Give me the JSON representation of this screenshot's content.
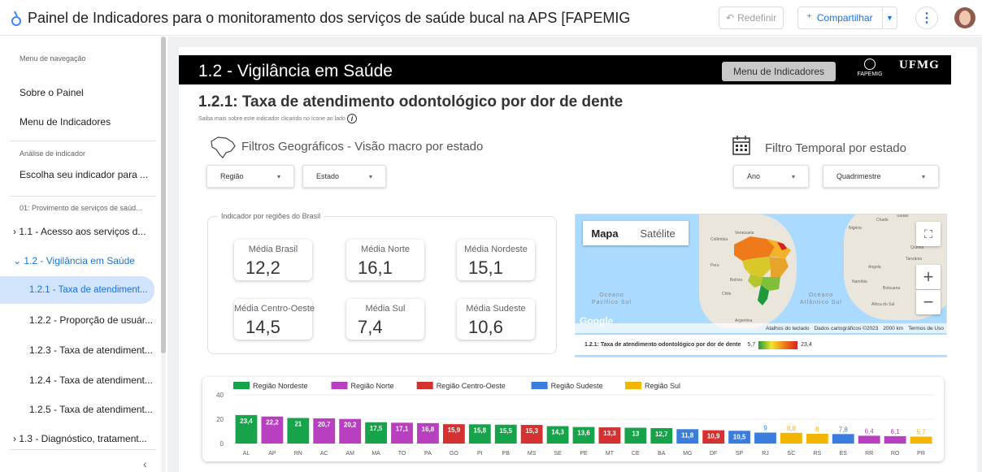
{
  "app": {
    "title": "Painel de Indicadores para o monitoramento dos serviços de saúde bucal na APS [FAPEMIG",
    "reset_label": "Redefinir",
    "share_label": "Compartilhar"
  },
  "sidebar": {
    "nav_caption": "Menu de navegação",
    "items_top": [
      "Sobre o Painel",
      "Menu de Indicadores"
    ],
    "analysis_caption": "Análise de indicador",
    "analysis_item": "Escolha seu indicador para ...",
    "section_caption": "01: Provimento de serviços de saúd...",
    "groups": [
      "› 1.1 - Acesso aos serviços d...",
      "⌄ 1.2 - Vigilância em Saúde"
    ],
    "sub_items": [
      "1.2.1 - Taxa de atendiment...",
      "1.2.2 - Proporção de usuár...",
      "1.2.3 - Taxa de atendiment...",
      "1.2.4 - Taxa de atendiment...",
      "1.2.5 - Taxa de atendiment..."
    ],
    "last_group": "› 1.3 - Diagnóstico, tratament...",
    "active_index": 0
  },
  "header": {
    "title": "1.2 - Vigilância em Saúde",
    "menu_button": "Menu de Indicadores",
    "fapemig": "FAPEMIG",
    "ufmg": "UFMG"
  },
  "indicator": {
    "title": "1.2.1: Taxa de atendimento odontológico por dor de dente",
    "subtitle": "Saiba mais sobre este indicador clicando no ícone ao lado"
  },
  "filters": {
    "geo_title": "Filtros Geográficos - Visão macro por estado",
    "time_title": "Filtro Temporal por estado",
    "regiao": "Região",
    "estado": "Estado",
    "ano": "Ano",
    "quadrimestre": "Quadrimestre"
  },
  "regions": {
    "label": "Indicador por regiões do Brasil",
    "cards": [
      {
        "label": "Média Brasil",
        "value": "12,2"
      },
      {
        "label": "Média Norte",
        "value": "16,1"
      },
      {
        "label": "Média Nordeste",
        "value": "15,1"
      },
      {
        "label": "Média Centro-Oeste",
        "value": "14,5"
      },
      {
        "label": "Média Sul",
        "value": "7,4"
      },
      {
        "label": "Média Sudeste",
        "value": "10,6"
      }
    ]
  },
  "map": {
    "tab_map": "Mapa",
    "tab_satellite": "Satélite",
    "google": "Google",
    "footer": [
      "Atalhos do teclado",
      "Dados cartográficos ©2023",
      "2000 km",
      "Termos de Uso"
    ],
    "legend_label": "1.2.1: Taxa de atendimento odontológico por dor de dente",
    "legend_min": "5,7",
    "legend_max": "23,4",
    "ocean_pacific": "Oceano\nPacífico Sul",
    "ocean_atlantic": "Oceano\nAtlântico Sul",
    "places": [
      "Venezuela",
      "Colômbia",
      "Peru",
      "Bolívia",
      "Chile",
      "Argentina",
      "Chade",
      "Nigéria",
      "Sudão",
      "Quênia",
      "Tanzânia",
      "Angola",
      "Namíbia",
      "Botsuana",
      "África do Sul"
    ]
  },
  "colors": {
    "Nordeste": "#16a34a",
    "Norte": "#b83fbf",
    "Centro-Oeste": "#d63131",
    "Sudeste": "#3b7ddd",
    "Sul": "#f2b600"
  },
  "chart_data": {
    "type": "bar",
    "legend": [
      "Região Nordeste",
      "Região Norte",
      "Região Centro-Oeste",
      "Região Sudeste",
      "Região Sul"
    ],
    "legend_keys": [
      "Nordeste",
      "Norte",
      "Centro-Oeste",
      "Sudeste",
      "Sul"
    ],
    "categories": [
      "AL",
      "AP",
      "RN",
      "AC",
      "AM",
      "MA",
      "TO",
      "PA",
      "GO",
      "PI",
      "PB",
      "MS",
      "SE",
      "PE",
      "MT",
      "CE",
      "BA",
      "MG",
      "DF",
      "SP",
      "RJ",
      "SC",
      "RS",
      "ES",
      "RR",
      "RO",
      "PR"
    ],
    "values": [
      23.4,
      22.2,
      21,
      20.7,
      20.2,
      17.5,
      17.1,
      16.8,
      15.9,
      15.8,
      15.5,
      15.3,
      14.3,
      13.6,
      13.3,
      13,
      12.7,
      11.8,
      10.9,
      10.5,
      9,
      8.8,
      8,
      7.8,
      6.4,
      6.1,
      5.7
    ],
    "labels": [
      "23,4",
      "22,2",
      "21",
      "20,7",
      "20,2",
      "17,5",
      "17,1",
      "16,8",
      "15,9",
      "15,8",
      "15,5",
      "15,3",
      "14,3",
      "13,6",
      "13,3",
      "13",
      "12,7",
      "11,8",
      "10,9",
      "10,5",
      "9",
      "8,8",
      "8",
      "7,8",
      "6,4",
      "6,1",
      "5,7"
    ],
    "regions": [
      "Nordeste",
      "Norte",
      "Nordeste",
      "Norte",
      "Norte",
      "Nordeste",
      "Norte",
      "Norte",
      "Centro-Oeste",
      "Nordeste",
      "Nordeste",
      "Centro-Oeste",
      "Nordeste",
      "Nordeste",
      "Centro-Oeste",
      "Nordeste",
      "Nordeste",
      "Sudeste",
      "Centro-Oeste",
      "Sudeste",
      "Sudeste",
      "Sul",
      "Sul",
      "Sudeste",
      "Norte",
      "Norte",
      "Sul"
    ],
    "yticks": [
      "0",
      "20",
      "40"
    ],
    "ylim": [
      0,
      40
    ]
  }
}
